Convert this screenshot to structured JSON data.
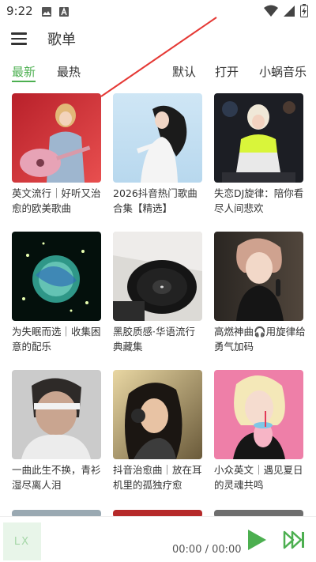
{
  "status": {
    "time": "9:22",
    "icons": [
      "image-icon",
      "a-badge-icon",
      "wifi-icon",
      "signal-icon",
      "battery-icon"
    ]
  },
  "header": {
    "title": "歌单",
    "menu_icon": "menu-icon"
  },
  "tabs": {
    "left": [
      {
        "label": "最新",
        "active": true
      },
      {
        "label": "最热",
        "active": false
      }
    ],
    "right": [
      {
        "label": "默认"
      },
      {
        "label": "打开"
      },
      {
        "label": "小蜗音乐"
      }
    ]
  },
  "playlists": [
    {
      "title": "英文流行｜好听又治愈的欧美歌曲"
    },
    {
      "title": "2026抖音热门歌曲合集【精选】"
    },
    {
      "title": "失恋DJ旋律：陪你看尽人间悲欢"
    },
    {
      "title": "为失眠而选｜收集困意的配乐"
    },
    {
      "title": "黑胶质感·华语流行典藏集"
    },
    {
      "title": "高燃神曲🎧用旋律给勇气加码"
    },
    {
      "title": "一曲此生不换，青衫湿尽离人泪"
    },
    {
      "title": "抖音治愈曲｜放在耳机里的孤独疗愈"
    },
    {
      "title": "小众英文｜遇见夏日的灵魂共鸣"
    }
  ],
  "player": {
    "logo_text": "LX",
    "time": "00:00 / 00:00",
    "accent": "#4caf50"
  }
}
